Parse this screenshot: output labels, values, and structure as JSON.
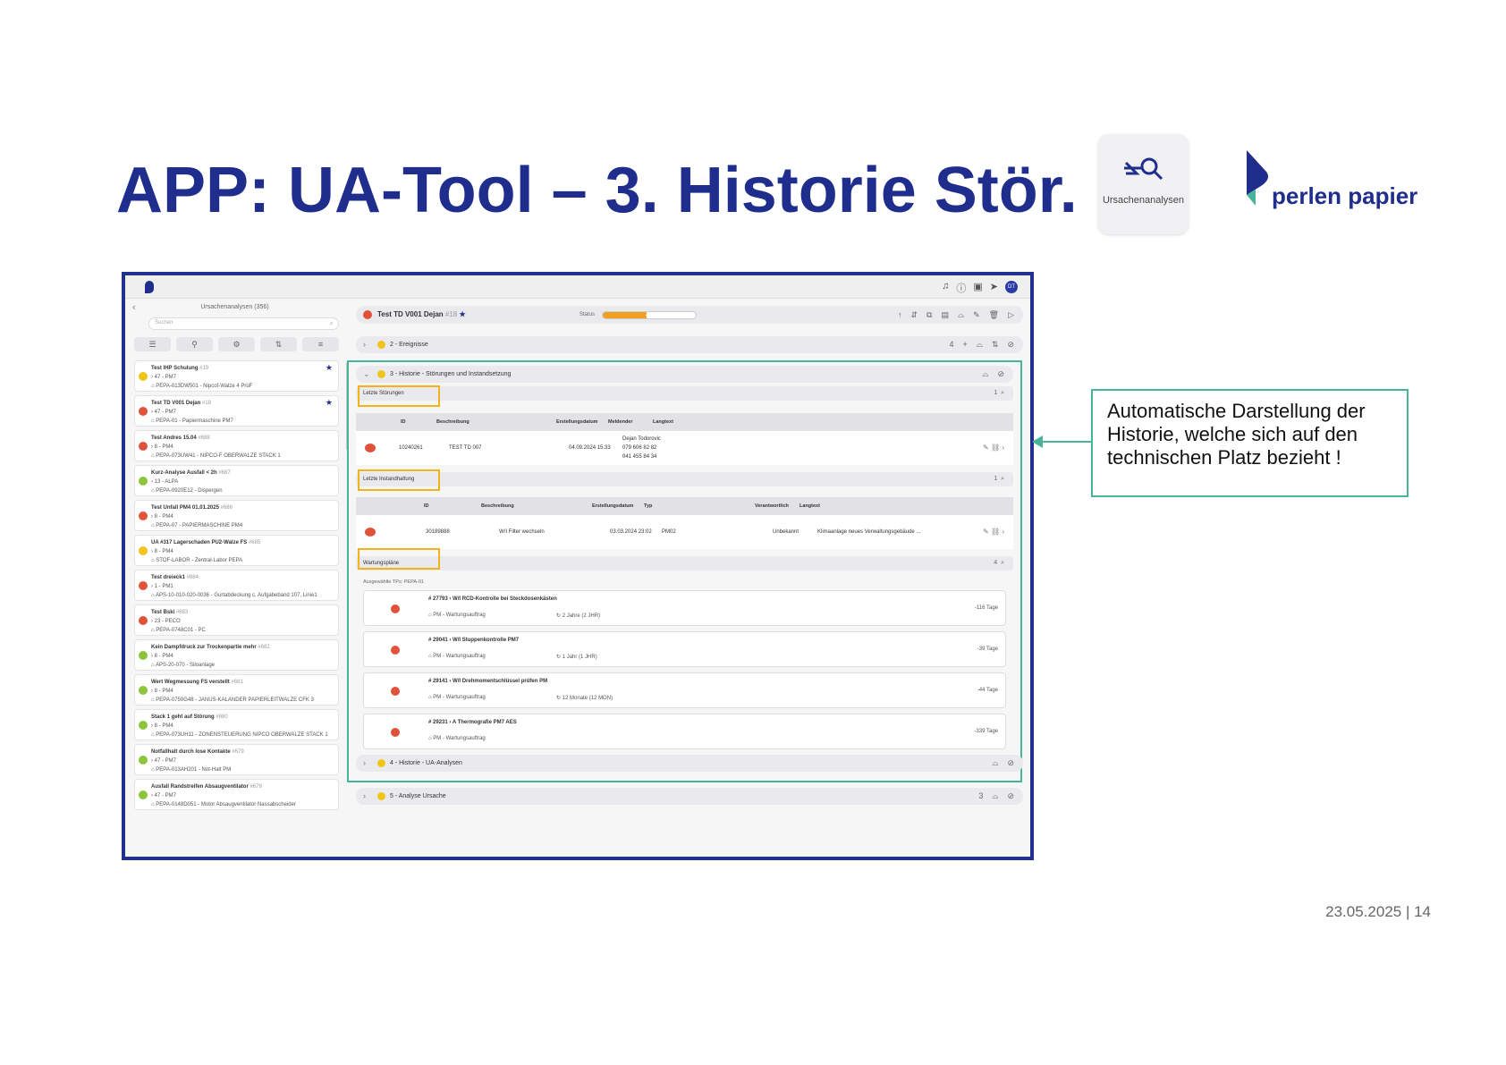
{
  "slide": {
    "title": "APP: UA-Tool – 3. Historie Stör.",
    "footer": "23.05.2025 | 14",
    "callout": "Automatische Darstellung der Historie, welche sich auf den technischen Platz bezieht !",
    "brand": "perlen papier",
    "app_tile_label": "Ursachenanalysen"
  },
  "sidebar": {
    "header": "Ursachenanalysen (356)",
    "search_placeholder": "Suchen",
    "cards": [
      {
        "title": "Test IHP Schulung",
        "num": "#19",
        "l2": "47 - PM7",
        "l3": "PEPA-013DW501 - Nipcof-Walze 4 PrüF",
        "color": "#f0c419",
        "star": true
      },
      {
        "title": "Test TD V001 Dejan",
        "num": "#18",
        "l2": "47 - PM7",
        "l3": "PEPA-01 - Papiermaschine PM7",
        "color": "#e0533a",
        "star": true
      },
      {
        "title": "Test Andres 15.04",
        "num": "#688",
        "l2": "8 - PM4",
        "l3": "PEPA-073UW41 - NIPCO-F OBERWALZE STACK 1",
        "color": "#e0533a",
        "star": false
      },
      {
        "title": "Kurz-Analyse Ausfall < 2h",
        "num": "#687",
        "l2": "13 - ALPA",
        "l3": "PEPA-0920E12 - Dispergen",
        "color": "#8cc43c",
        "star": false
      },
      {
        "title": "Test Unfall PM4 01.01.2025",
        "num": "#686",
        "l2": "8 - PM4",
        "l3": "PEPA-07 - PAPIERMASCHINE PM4",
        "color": "#e0533a",
        "star": false
      },
      {
        "title": "UA #317 Lagerschaden PU2-Walze FS",
        "num": "#685",
        "l2": "8 - PM4",
        "l3": "STOF-LABOR - Zentral-Labor PEPA",
        "color": "#f0c419",
        "star": false
      },
      {
        "title": "Test dreieck1",
        "num": "#684",
        "l2": "1 - PM1",
        "l3": "APS-10-010-020-0036 - Gurtabdeckung c. Aufgabeband 107, Linie1",
        "color": "#e0533a",
        "star": false
      },
      {
        "title": "Test Bski",
        "num": "#683",
        "l2": "23 - PECO",
        "l3": "PEPA-0748C01 - PC",
        "color": "#e0533a",
        "star": false
      },
      {
        "title": "Kein Dampfdruck zur Trockenpartie mehr",
        "num": "#682",
        "l2": "8 - PM4",
        "l3": "APS-20-070 - Siloanlage",
        "color": "#8cc43c",
        "star": false
      },
      {
        "title": "Wert Wegmessung FS verstellt",
        "num": "#681",
        "l2": "8 - PM4",
        "l3": "PEPA-0750G48 - JANUS-KALANDER PAPIERLEITWALZE CFK 3",
        "color": "#8cc43c",
        "star": false
      },
      {
        "title": "Stack 1 geht auf Störung",
        "num": "#680",
        "l2": "8 - PM4",
        "l3": "PEPA-073UH11 - ZONENSTEUERUNG NIPCO OBERWALZE STACK 1",
        "color": "#8cc43c",
        "star": false
      },
      {
        "title": "Notfallhalt durch lose Kontakte",
        "num": "#679",
        "l2": "47 - PM7",
        "l3": "PEPA-013AH201 - Not-Halt PM",
        "color": "#8cc43c",
        "star": false
      },
      {
        "title": "Ausfall Randstreifen Absaugventilator",
        "num": "#678",
        "l2": "47 - PM7",
        "l3": "PEPA-0148D051 - Motor Absaugventilator Nassabscheider",
        "color": "#8cc43c",
        "star": false
      }
    ]
  },
  "main": {
    "record_title": "Test TD V001 Dejan",
    "record_num": "#18",
    "status_label": "Status",
    "progress_percent": "47%",
    "progress_fraction": 0.47,
    "sec2": "2 - Ereignisse",
    "sec2_count": "4",
    "sec3": "3 - Historie - Störungen und Instandsetzung",
    "stoer_label": "Letzte Störungen",
    "stoer_count": "1",
    "stoer_headers": [
      "ID",
      "Beschreibung",
      "Erstellungsdatum",
      "Meldender",
      "Langtext"
    ],
    "stoer_row": {
      "id": "10240261",
      "desc": "TEST TD 007",
      "date": "04.09.2024 15:33",
      "m1": "Dejan Todorovic",
      "m2": "079 606 82 82",
      "m3": "041 455 84 34"
    },
    "inst_label": "Letzte Instandhaltung",
    "inst_count": "1",
    "inst_headers": [
      "ID",
      "Beschreibung",
      "Erstellungsdatum",
      "Typ",
      "Verantwortlich",
      "Langtext"
    ],
    "inst_row": {
      "id": "30189888",
      "desc": "W/I Filter wechseln",
      "date": "03.03.2024 23:02",
      "typ": "PM02",
      "resp": "Unbekannt",
      "text": "Klimaanlage neues Verwaltungsgebäude ..."
    },
    "wp_label": "Wartungspläne",
    "wp_count": "4",
    "wp_sub": "Ausgewählte TPs: PEPA-01",
    "plans": [
      {
        "id": "27793",
        "name": "W/I RCD-Kontrolle bei Steckdosenkästen",
        "type": "PM - Wartungsauftrag",
        "cycle": "2 Jahre (2 JHR)",
        "days": "-116 Tage"
      },
      {
        "id": "29041",
        "name": "W/I Stuppenkontrolle PM7",
        "type": "PM - Wartungsauftrag",
        "cycle": "1 Jahr (1 JHR)",
        "days": "-39 Tage"
      },
      {
        "id": "29141",
        "name": "W/I Drehmomentschlüssel prüfen PM",
        "type": "PM - Wartungsauftrag",
        "cycle": "12 Monate (12 MON)",
        "days": "-44 Tage"
      },
      {
        "id": "29231",
        "name": "A Thermografie PM7 AES",
        "type": "PM - Wartungsauftrag",
        "cycle": "",
        "days": "-339 Tage"
      }
    ],
    "sec4": "4 - Historie - UA-Analysen",
    "sec5": "5 - Analyse Ursache",
    "sec5_count": "3"
  }
}
